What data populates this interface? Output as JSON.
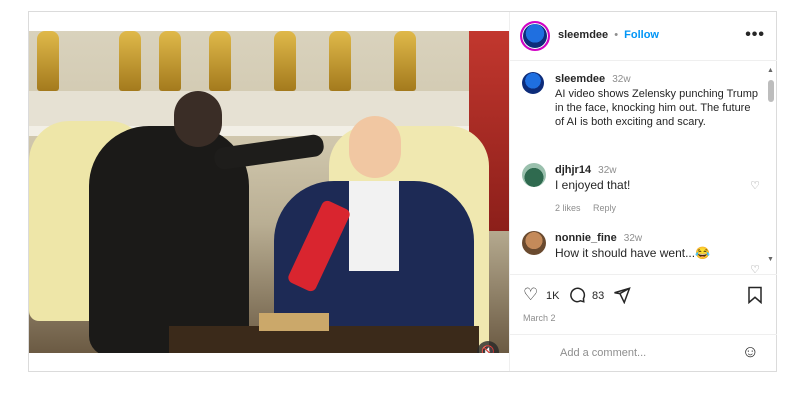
{
  "post": {
    "username": "sleemdee",
    "follow_label": "Follow",
    "separator": "•",
    "more_label": "•••"
  },
  "caption": {
    "username": "sleemdee",
    "time": "32w",
    "text": "AI video shows Zelensky punching Trump in the face, knocking him out. The future of AI is both exciting and scary."
  },
  "comments": [
    {
      "username": "djhjr14",
      "time": "32w",
      "text": "I enjoyed that!",
      "likes": "2 likes",
      "reply": "Reply"
    },
    {
      "username": "nonnie_fine",
      "time": "32w",
      "text": "How it should have went...😂"
    }
  ],
  "actions": {
    "likes_count": "1K",
    "comments_count": "83",
    "date": "March 2"
  },
  "add_comment": {
    "placeholder": "Add a comment..."
  },
  "icons": {
    "like": "heart-icon",
    "comment": "comment-icon",
    "share": "send-icon",
    "save": "bookmark-icon",
    "emoji": "emoji-icon",
    "mute": "speaker-muted-icon"
  },
  "colors": {
    "accent": "#0095f6",
    "border": "#dbdbdb",
    "muted_text": "#8e8e8e"
  }
}
